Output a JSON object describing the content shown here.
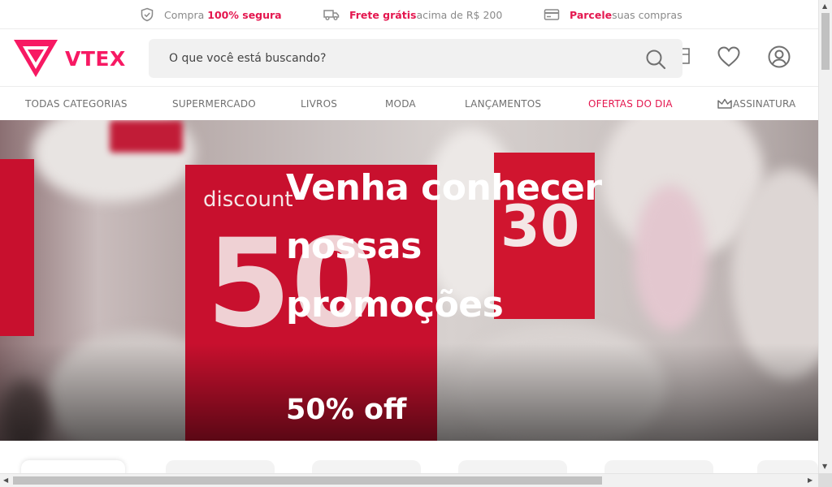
{
  "topbar": {
    "secure": {
      "prefix": "Compra ",
      "highlight": "100% segura"
    },
    "shipping": {
      "highlight": "Frete grátis",
      "suffix": " acima de R$ 200"
    },
    "installments": {
      "highlight": "Parcele",
      "suffix": " suas compras"
    }
  },
  "header": {
    "logo_text": "VTEX",
    "search_placeholder": "O que você está buscando?"
  },
  "nav": {
    "items": [
      "TODAS CATEGORIAS",
      "SUPERMERCADO",
      "LIVROS",
      "MODA",
      "LANÇAMENTOS",
      "OFERTAS DO DIA",
      "ASSINATURA"
    ]
  },
  "hero": {
    "title": "Venha conhecer nossas promoções",
    "subtitle": "50% off",
    "sign_discount": "discount",
    "sign_fifty": "50",
    "sign_thirty": "30"
  },
  "colors": {
    "brand": "#f71963",
    "accent": "#e4174f"
  }
}
